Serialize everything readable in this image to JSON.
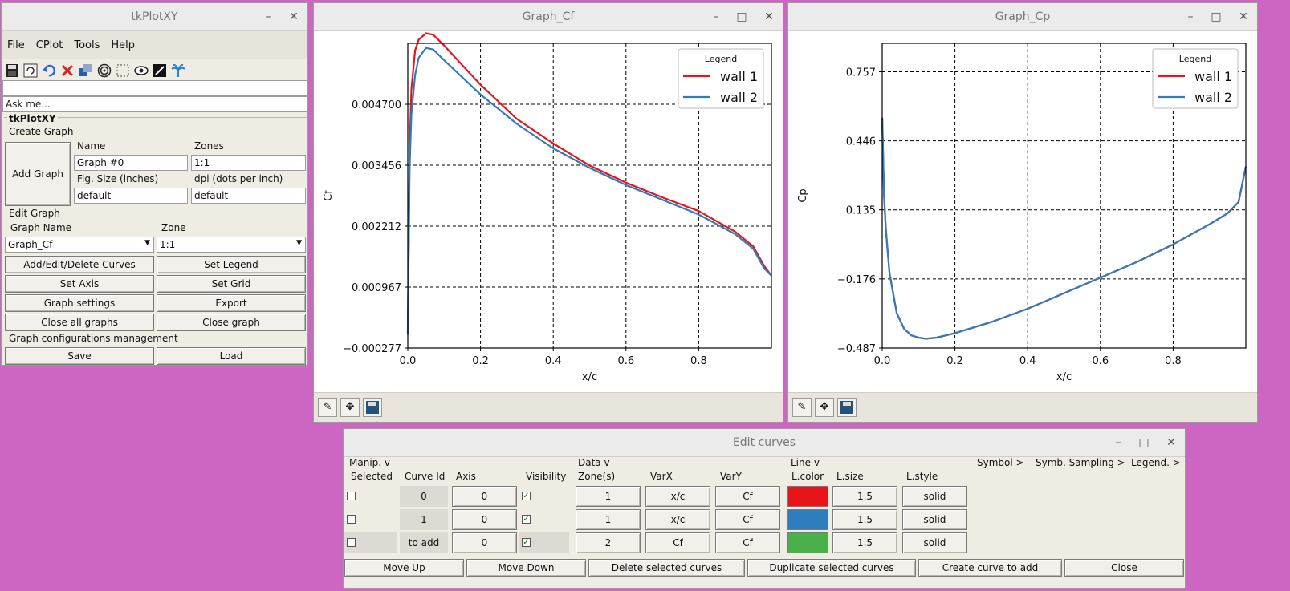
{
  "main_window": {
    "title": "tkPlotXY",
    "menu": [
      "File",
      "CPlot",
      "Tools",
      "Help"
    ],
    "toolbar_icons": [
      "save-icon",
      "refresh-icon",
      "undo-icon",
      "delete-icon",
      "copy-icon",
      "target-icon",
      "fit-icon",
      "eye-icon",
      "dark-mode-icon",
      "palm-icon"
    ],
    "command_value": "",
    "ask_placeholder": "Ask me...",
    "panel_title": "tkPlotXY",
    "create_graph": {
      "section": "Create Graph",
      "add_graph": "Add Graph",
      "name_label": "Name",
      "zones_label": "Zones",
      "name_value": "Graph #0",
      "zones_value": "1:1",
      "figsize_label": "Fig. Size (inches)",
      "dpi_label": "dpi (dots per inch)",
      "figsize_value": "default",
      "dpi_value": "default"
    },
    "edit_graph": {
      "section": "Edit Graph",
      "graph_name_label": "Graph Name",
      "zone_label": "Zone",
      "graph_name_value": "Graph_Cf",
      "zone_value": "1:1",
      "add_edit_delete": "Add/Edit/Delete Curves",
      "set_legend": "Set Legend",
      "set_axis": "Set Axis",
      "set_grid": "Set Grid",
      "graph_settings": "Graph settings",
      "export": "Export",
      "close_all": "Close all graphs",
      "close_graph": "Close graph"
    },
    "config": {
      "section": "Graph configurations management",
      "save": "Save",
      "load": "Load"
    }
  },
  "graph_cf": {
    "title": "Graph_Cf",
    "footer_icons": [
      "edit-icon",
      "move-icon",
      "save-icon"
    ]
  },
  "graph_cp": {
    "title": "Graph_Cp",
    "footer_icons": [
      "edit-icon",
      "move-icon",
      "save-icon"
    ]
  },
  "chart_data": [
    {
      "type": "line",
      "title": "",
      "xlabel": "x/c",
      "ylabel": "Cf",
      "xlim": [
        0.0,
        1.0
      ],
      "ylim": [
        -0.000277,
        0.005945
      ],
      "xticks": [
        "0.0",
        "0.2",
        "0.4",
        "0.6",
        "0.8"
      ],
      "yticks": [
        "−0.000277",
        "0.000967",
        "0.002212",
        "0.003456",
        "0.004700"
      ],
      "ytick_values": [
        -0.000277,
        0.000967,
        0.002212,
        0.003456,
        0.0047
      ],
      "grid": true,
      "legend": {
        "title": "Legend",
        "position": "top-right"
      },
      "x": [
        0.0,
        0.005,
        0.01,
        0.02,
        0.03,
        0.05,
        0.07,
        0.1,
        0.15,
        0.2,
        0.3,
        0.4,
        0.5,
        0.6,
        0.7,
        0.8,
        0.9,
        0.95,
        0.98,
        1.0
      ],
      "series": [
        {
          "name": "wall 1",
          "color": "#e8141c",
          "values": [
            0.0,
            0.0038,
            0.005,
            0.0058,
            0.00602,
            0.00615,
            0.00612,
            0.0059,
            0.0055,
            0.0051,
            0.0044,
            0.0039,
            0.00345,
            0.0031,
            0.0028,
            0.00252,
            0.0021,
            0.0018,
            0.0014,
            0.0012
          ]
        },
        {
          "name": "wall 2",
          "color": "#2f7cbf",
          "values": [
            0.0,
            0.0034,
            0.0045,
            0.0053,
            0.00565,
            0.00585,
            0.00582,
            0.0056,
            0.00525,
            0.0049,
            0.0043,
            0.0038,
            0.0034,
            0.00305,
            0.00275,
            0.00245,
            0.00205,
            0.00175,
            0.00135,
            0.0012
          ]
        }
      ]
    },
    {
      "type": "line",
      "title": "",
      "xlabel": "x/c",
      "ylabel": "Cp",
      "xlim": [
        0.0,
        1.0
      ],
      "ylim": [
        -0.487,
        0.885
      ],
      "xticks": [
        "0.0",
        "0.2",
        "0.4",
        "0.6",
        "0.8"
      ],
      "yticks": [
        "−0.487",
        "−0.176",
        "0.135",
        "0.446",
        "0.757"
      ],
      "ytick_values": [
        -0.487,
        -0.176,
        0.135,
        0.446,
        0.757
      ],
      "grid": true,
      "legend": {
        "title": "Legend",
        "position": "top-right"
      },
      "x": [
        0.0,
        0.005,
        0.01,
        0.02,
        0.04,
        0.06,
        0.08,
        0.1,
        0.12,
        0.15,
        0.2,
        0.3,
        0.4,
        0.5,
        0.6,
        0.7,
        0.8,
        0.9,
        0.95,
        0.98,
        1.0
      ],
      "series": [
        {
          "name": "wall 1",
          "color": "#e8141c",
          "values": [
            0.55,
            0.2,
            0.05,
            -0.15,
            -0.33,
            -0.4,
            -0.43,
            -0.44,
            -0.445,
            -0.44,
            -0.42,
            -0.37,
            -0.31,
            -0.24,
            -0.17,
            -0.1,
            -0.02,
            0.07,
            0.12,
            0.17,
            0.33
          ]
        },
        {
          "name": "wall 2",
          "color": "#2f7cbf",
          "values": [
            0.55,
            0.2,
            0.05,
            -0.15,
            -0.33,
            -0.4,
            -0.43,
            -0.44,
            -0.445,
            -0.44,
            -0.42,
            -0.37,
            -0.31,
            -0.24,
            -0.17,
            -0.1,
            -0.02,
            0.07,
            0.12,
            0.17,
            0.33
          ]
        }
      ]
    }
  ],
  "edit_curves": {
    "title": "Edit  curves",
    "group_headers": {
      "manip": "Manip. v",
      "data": "Data v",
      "line": "Line v",
      "symbol": "Symbol >",
      "sampling": "Symb. Sampling >",
      "legend": "Legend. >"
    },
    "columns": {
      "selected": "Selected",
      "curve_id": "Curve Id",
      "axis": "Axis",
      "visibility": "Visibility",
      "zones": "Zone(s)",
      "varx": "VarX",
      "vary": "VarY",
      "lcolor": "L.color",
      "lsize": "L.size",
      "lstyle": "L.style"
    },
    "rows": [
      {
        "curve_id": "0",
        "axis": "0",
        "zones": "1",
        "varx": "x/c",
        "vary": "Cf",
        "color": "#e8141c",
        "lsize": "1.5",
        "lstyle": "solid"
      },
      {
        "curve_id": "1",
        "axis": "0",
        "zones": "1",
        "varx": "x/c",
        "vary": "Cf",
        "color": "#2f7cbf",
        "lsize": "1.5",
        "lstyle": "solid"
      },
      {
        "curve_id": "to add",
        "axis": "0",
        "zones": "2",
        "varx": "Cf",
        "vary": "Cf",
        "color": "#4ab04a",
        "lsize": "1.5",
        "lstyle": "solid"
      }
    ],
    "buttons": {
      "move_up": "Move Up",
      "move_down": "Move Down",
      "delete_selected": "Delete selected curves",
      "duplicate_selected": "Duplicate selected curves",
      "create_curve": "Create curve to add",
      "close": "Close"
    }
  }
}
